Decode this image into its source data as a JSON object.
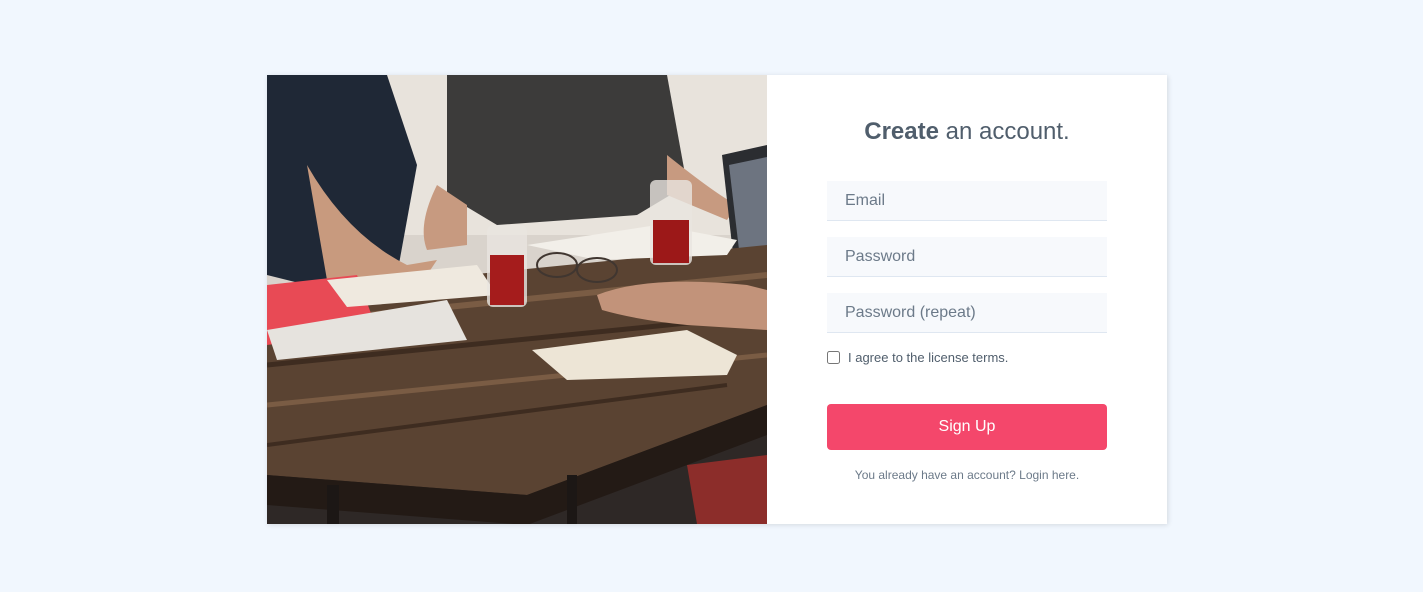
{
  "image": {
    "description": "people working at a wooden table with drinks and notebooks"
  },
  "form": {
    "title_strong": "Create",
    "title_rest": " an account.",
    "email": {
      "placeholder": "Email",
      "value": ""
    },
    "password": {
      "placeholder": "Password",
      "value": ""
    },
    "password_repeat": {
      "placeholder": "Password (repeat)",
      "value": ""
    },
    "terms": {
      "label": "I agree to the license terms.",
      "checked": false
    },
    "submit_label": "Sign Up",
    "login_prompt": "You already have an account? Login here."
  },
  "colors": {
    "page_background": "#f1f7fe",
    "accent": "#f4476b",
    "text": "#505e6c",
    "input_background": "#f7f9fc"
  }
}
